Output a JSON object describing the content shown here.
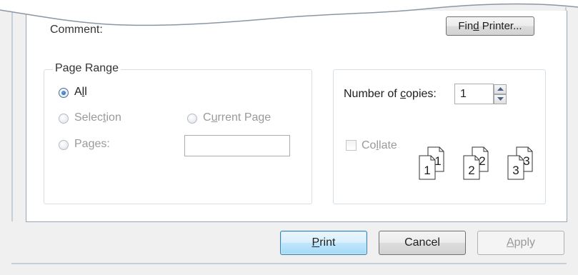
{
  "comment": {
    "label": "Comment:"
  },
  "find_printer": {
    "pre": "Fin",
    "key": "d",
    "post": " Printer..."
  },
  "page_range": {
    "title": "Page Range",
    "all": {
      "pre": "A",
      "key": "l",
      "post": "l"
    },
    "selection": {
      "pre": "Selec",
      "key": "t",
      "post": "ion"
    },
    "current_page": {
      "pre": "C",
      "key": "u",
      "post": "rrent Page"
    },
    "pages": {
      "pre": "Pa",
      "key": "g",
      "post": "es:"
    },
    "pages_value": ""
  },
  "copies": {
    "label_pre": "Number of ",
    "label_key": "c",
    "label_post": "opies:",
    "value": "1"
  },
  "collate": {
    "pre": "Co",
    "key": "l",
    "post": "late",
    "checked": false
  },
  "collate_pages": [
    {
      "back": "1",
      "front": "1"
    },
    {
      "back": "2",
      "front": "2"
    },
    {
      "back": "3",
      "front": "3"
    }
  ],
  "buttons": {
    "print": {
      "pre": "",
      "key": "P",
      "post": "rint"
    },
    "cancel": "Cancel",
    "apply": {
      "pre": "",
      "key": "A",
      "post": "pply"
    }
  }
}
